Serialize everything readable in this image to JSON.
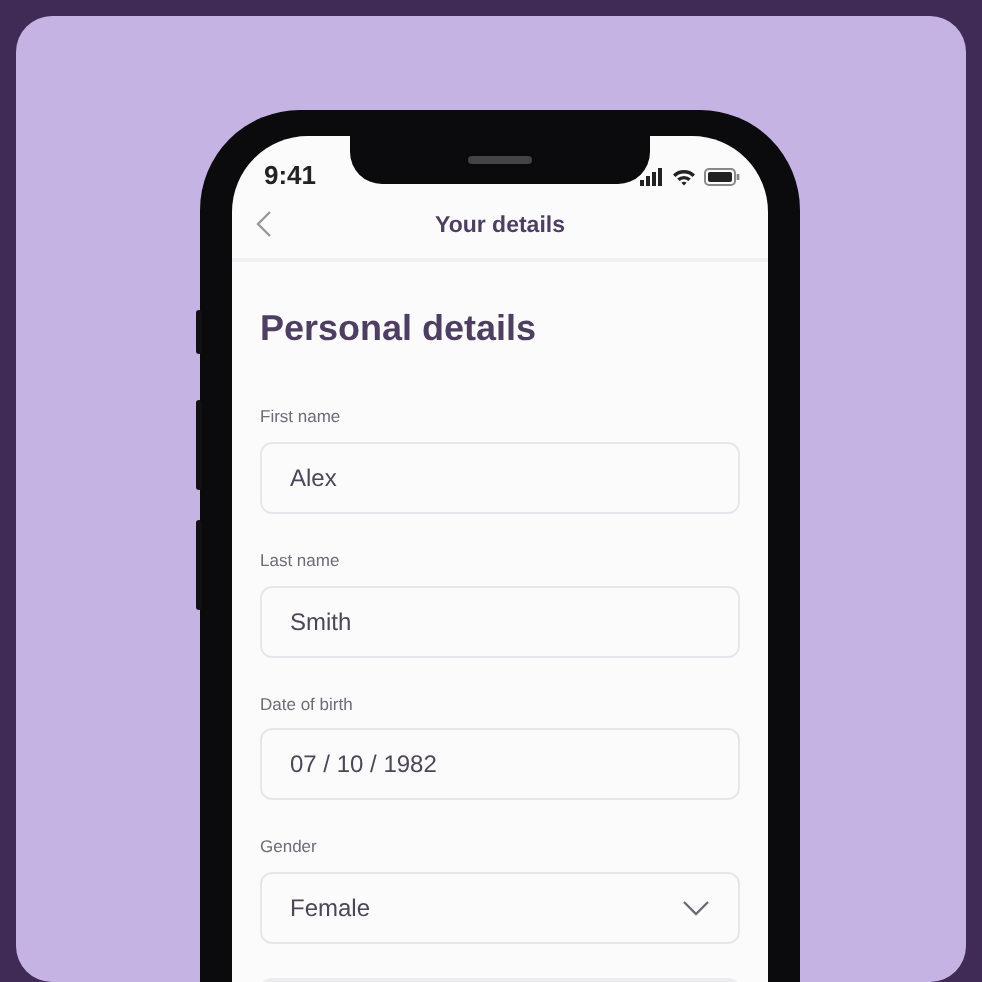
{
  "status_bar": {
    "time": "9:41"
  },
  "header": {
    "title": "Your details"
  },
  "heading": "Personal details",
  "fields": [
    {
      "kind": "text",
      "label": "First name",
      "value": "Alex"
    },
    {
      "kind": "text",
      "label": "Last name",
      "value": "Smith"
    },
    {
      "kind": "text",
      "label": "Date of birth",
      "value": "07 / 10 / 1982"
    },
    {
      "kind": "select",
      "label": "Gender",
      "value": "Female"
    }
  ]
}
